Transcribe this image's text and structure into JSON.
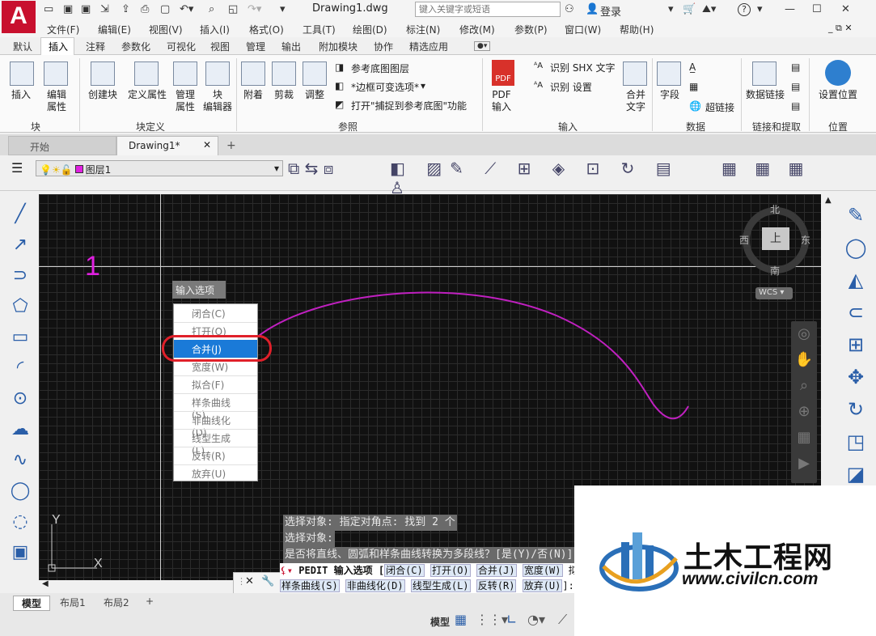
{
  "app": {
    "logo_letter": "A",
    "doc_title": "Drawing1.dwg"
  },
  "search": {
    "placeholder": "键入关键字或短语"
  },
  "top": {
    "login": "登录",
    "help": "?"
  },
  "menu": [
    "文件(F)",
    "编辑(E)",
    "视图(V)",
    "插入(I)",
    "格式(O)",
    "工具(T)",
    "绘图(D)",
    "标注(N)",
    "修改(M)",
    "参数(P)",
    "窗口(W)",
    "帮助(H)"
  ],
  "ribbon_tabs": [
    "默认",
    "插入",
    "注释",
    "参数化",
    "可视化",
    "视图",
    "管理",
    "输出",
    "附加模块",
    "协作",
    "精选应用"
  ],
  "ribbon": {
    "insert": "插入",
    "edit_attr": "编辑\n属性",
    "create_block": "创建块",
    "define_attr": "定义属性",
    "manage_attr": "管理\n属性",
    "block_editor": "块\n编辑器",
    "attach": "附着",
    "clip": "剪裁",
    "adjust": "调整",
    "underlay_layers": "参考底图图层",
    "frame_var": "*边框可变选项*",
    "snap_underlay": "打开\"捕捉到参考底图\"功能",
    "pdf_import": "PDF\n输入",
    "shx_text": "识别 SHX 文字",
    "recog_settings": "识别 设置",
    "combine_text": "合并\n文字",
    "field": "字段",
    "hyperlink": "超链接",
    "data_link": "数据链接",
    "set_location": "设置位置",
    "groups": {
      "block": "块",
      "block_def": "块定义",
      "reference": "参照",
      "import": "输入",
      "data": "数据",
      "link_extract": "链接和提取",
      "location": "位置"
    }
  },
  "doc_tabs": {
    "start": "开始",
    "drawing": "Drawing1*",
    "plus": "+"
  },
  "layer": {
    "name": "图层1"
  },
  "canvas": {
    "marker": "1",
    "compass": {
      "n": "北",
      "s": "南",
      "e": "东",
      "w": "西",
      "cube": "上"
    },
    "wcs": "WCS"
  },
  "options": {
    "label": "输入选项",
    "items": [
      "闭合(C)",
      "打开(O)",
      "合并(J)",
      "宽度(W)",
      "拟合(F)",
      "样条曲线(S)",
      "非曲线化(D)",
      "线型生成(L)",
      "反转(R)",
      "放弃(U)"
    ],
    "selected_index": 2
  },
  "command": {
    "history": [
      "选择对象: 指定对角点: 找到 2 个",
      "选择对象:",
      "是否将直线、圆弧和样条曲线转换为多段线？[是(Y)/否(N)]?"
    ],
    "prompt_head": "PEDIT 输入选项 [",
    "line1_kw": [
      "闭合(C)",
      "打开(O)",
      "合并(J)",
      "宽度(W)"
    ],
    "line1_tail": "拟",
    "line2_kw": [
      "样条曲线(S)",
      "非曲线化(D)",
      "线型生成(L)",
      "反转(R)",
      "放弃(U)"
    ],
    "line2_tail": "]:"
  },
  "layout_tabs": [
    "模型",
    "布局1",
    "布局2",
    "+"
  ],
  "status": {
    "model": "模型"
  },
  "watermark": {
    "name": "土木工程网",
    "url": "www.civilcn.com"
  },
  "colors": {
    "accent": "#1a7ad8",
    "highlight": "#e0202a",
    "curve": "#c020c0",
    "logo": "#c8102e"
  }
}
